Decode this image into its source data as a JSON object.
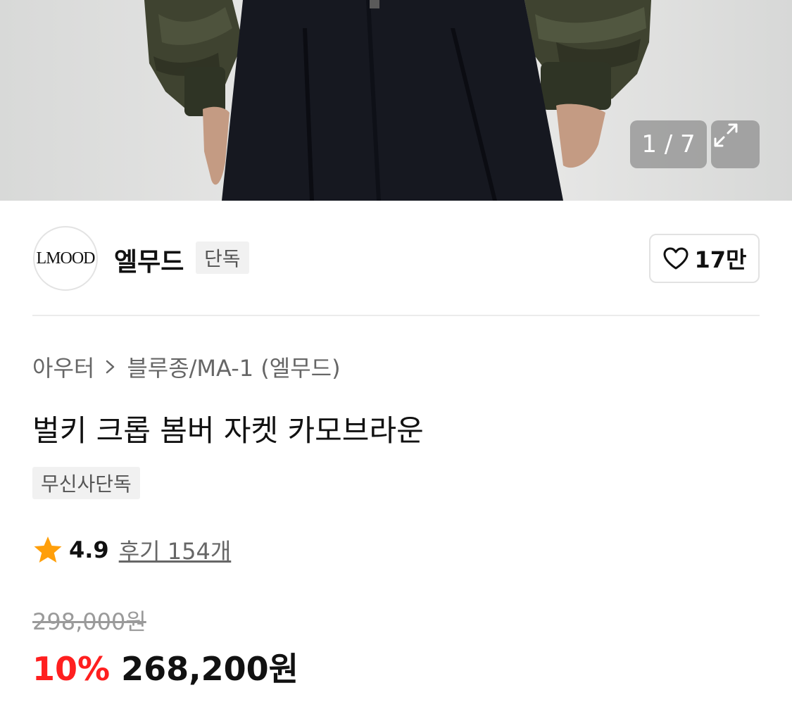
{
  "gallery": {
    "counter": "1 / 7",
    "expand_icon": "expand-arrows-icon"
  },
  "brand": {
    "logo_text": "LMOOD",
    "name": "엘무드",
    "badge": "단독",
    "like_count": "17만",
    "like_icon": "heart-outline-icon"
  },
  "breadcrumb": {
    "category": "아우터",
    "separator_icon": "chevron-right-icon",
    "subcategory": "블루종/MA-1 (엘무드)"
  },
  "product": {
    "title": "벌키 크롭 봄버 자켓 카모브라운",
    "tag": "무신사단독",
    "rating": "4.9",
    "rating_icon": "star-icon",
    "reviews": "후기 154개",
    "original_price": "298,000원",
    "discount": "10%",
    "price": "268,200원"
  },
  "colors": {
    "discount": "#ff1f1f",
    "star": "#ff9f0a",
    "badge_bg": "#f1f1f1"
  }
}
